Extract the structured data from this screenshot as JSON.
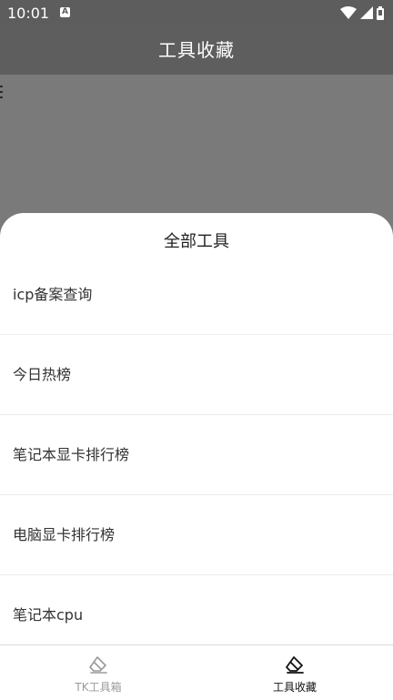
{
  "status_bar": {
    "time": "10:01",
    "notification_icon": "a-icon",
    "icons": [
      "wifi-icon",
      "signal-icon",
      "battery-icon"
    ]
  },
  "header": {
    "title": "工具收藏"
  },
  "sheet": {
    "title": "全部工具",
    "items": [
      {
        "label": "icp备案查询"
      },
      {
        "label": "今日热榜"
      },
      {
        "label": "笔记本显卡排行榜"
      },
      {
        "label": "电脑显卡排行榜"
      },
      {
        "label": "笔记本cpu"
      }
    ]
  },
  "bottom_nav": {
    "items": [
      {
        "label": "TK工具箱",
        "icon": "eraser-icon",
        "active": false
      },
      {
        "label": "工具收藏",
        "icon": "eraser-icon",
        "active": true
      }
    ]
  },
  "colors": {
    "status_bar": "#5d5d5d",
    "header": "#5e5e5e",
    "backdrop": "#7a7a7a",
    "active_nav": "#111111",
    "inactive_nav": "#9a9a9a"
  }
}
